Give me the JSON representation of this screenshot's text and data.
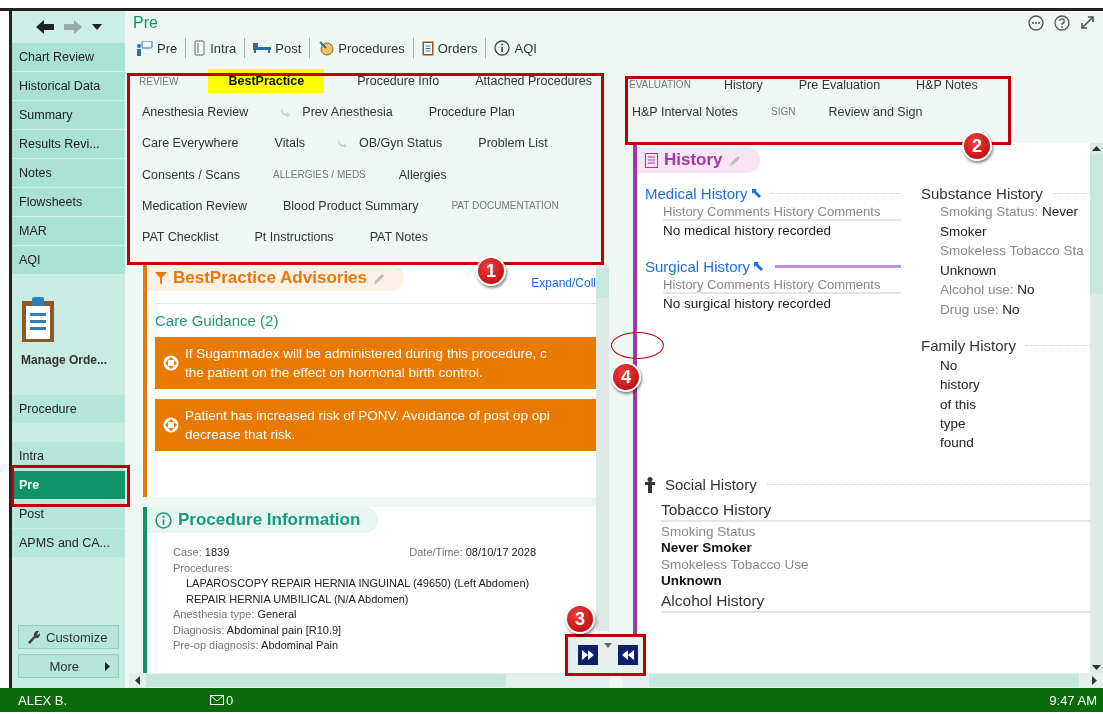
{
  "sidebar": {
    "items": [
      {
        "label": "Chart Review",
        "selected": false
      },
      {
        "label": "Historical Data",
        "selected": false
      },
      {
        "label": "Summary",
        "selected": false
      },
      {
        "label": "Results Revi...",
        "selected": false
      },
      {
        "label": "Notes",
        "selected": false
      },
      {
        "label": "Flowsheets",
        "selected": false
      },
      {
        "label": "MAR",
        "selected": false
      },
      {
        "label": "AQI",
        "selected": false
      }
    ],
    "manage_orders": "Manage Orde...",
    "activities": [
      {
        "label": "Procedure",
        "selected": false
      },
      {
        "label": "Intra",
        "selected": false
      },
      {
        "label": "Pre",
        "selected": true
      },
      {
        "label": "Post",
        "selected": false
      },
      {
        "label": "APMS and CA...",
        "selected": false
      }
    ],
    "customize": "Customize",
    "more": "More"
  },
  "header": {
    "title": "Pre"
  },
  "toolbar": [
    {
      "label": "Pre",
      "kind": "pre"
    },
    {
      "label": "Intra",
      "kind": "intra"
    },
    {
      "label": "Post",
      "kind": "post"
    },
    {
      "label": "Procedures",
      "kind": "procedures"
    },
    {
      "label": "Orders",
      "kind": "orders"
    },
    {
      "label": "AQI",
      "kind": "info"
    }
  ],
  "left_nav": {
    "rows": [
      [
        {
          "label": "REVIEW",
          "kind": "header"
        },
        {
          "label": "BestPractice",
          "kind": "link",
          "selected": true
        },
        {
          "label": "Procedure Info",
          "kind": "link",
          "selected": false
        },
        {
          "label": "Attached Procedures",
          "kind": "link",
          "selected": false
        }
      ],
      [
        {
          "label": "Anesthesia Review",
          "kind": "link",
          "selected": false
        },
        {
          "label": "Prev Anesthesia",
          "kind": "sublink",
          "selected": false
        },
        {
          "label": "Procedure Plan",
          "kind": "link",
          "selected": false
        }
      ],
      [
        {
          "label": "Care Everywhere",
          "kind": "link",
          "selected": false
        },
        {
          "label": "Vitals",
          "kind": "link",
          "selected": false
        },
        {
          "label": "OB/Gyn Status",
          "kind": "sublink",
          "selected": false
        },
        {
          "label": "Problem List",
          "kind": "link",
          "selected": false
        }
      ],
      [
        {
          "label": "Consents / Scans",
          "kind": "link",
          "selected": false
        },
        {
          "label": "ALLERGIES / MEDS",
          "kind": "header"
        },
        {
          "label": "Allergies",
          "kind": "link",
          "selected": false
        }
      ],
      [
        {
          "label": "Medication Review",
          "kind": "link",
          "selected": false
        },
        {
          "label": "Blood Product Summary",
          "kind": "link",
          "selected": false
        },
        {
          "label": "PAT DOCUMENTATION",
          "kind": "header"
        }
      ],
      [
        {
          "label": "PAT Checklist",
          "kind": "link",
          "selected": false
        },
        {
          "label": "Pt Instructions",
          "kind": "link",
          "selected": false
        },
        {
          "label": "PAT Notes",
          "kind": "link",
          "selected": false
        }
      ]
    ]
  },
  "advisories": {
    "title": "BestPractice Advisories",
    "expand_link": "Expand/Coll",
    "group": "Care Guidance (2)",
    "alerts": [
      {
        "lines": [
          "If Sugammadex will be administered during this procedure, c",
          "the patient on the effect on hormonal birth control."
        ]
      },
      {
        "lines": [
          "Patient has increased risk of PONV. Avoidance of post op opi",
          "decrease that risk."
        ]
      }
    ]
  },
  "procedure_info": {
    "title": "Procedure Information",
    "case": {
      "label": "Case:",
      "value": "1839"
    },
    "datetime": {
      "label": "Date/Time:",
      "value": "08/10/17 2028"
    },
    "procedures_label": "Procedures:",
    "procedures": [
      "LAPAROSCOPY REPAIR HERNIA INGUINAL (49650) (Left Abdomen)",
      "REPAIR HERNIA UMBILICAL (N/A Abdomen)"
    ],
    "fields": [
      {
        "label": "Anesthesia type:",
        "value": "General"
      },
      {
        "label": "Diagnosis:",
        "value": "Abdominal pain [R10.9]"
      },
      {
        "label": "Pre-op diagnosis:",
        "value": "Abdominal Pain"
      }
    ]
  },
  "right_nav": {
    "rows": [
      [
        {
          "label": "EVALUATION",
          "kind": "header"
        },
        {
          "label": "History",
          "kind": "link",
          "selected": false
        },
        {
          "label": "Pre Evaluation",
          "kind": "link",
          "selected": false
        },
        {
          "label": "H&P Notes",
          "kind": "link",
          "selected": false
        }
      ],
      [
        {
          "label": "H&P Interval Notes",
          "kind": "link",
          "selected": false
        },
        {
          "label": "SIGN",
          "kind": "header"
        },
        {
          "label": "Review and Sign",
          "kind": "link",
          "selected": false
        }
      ]
    ]
  },
  "history": {
    "title": "History",
    "medical": {
      "title": "Medical History",
      "comments": "History Comments History Comments",
      "text": "No medical history recorded"
    },
    "surgical": {
      "title": "Surgical History",
      "comments": "History Comments History Comments",
      "text": "No surgical history recorded"
    },
    "substance": {
      "title": "Substance History",
      "entries": [
        {
          "label": "Smoking Status:",
          "value": "Never Smoker"
        },
        {
          "label": "Smokeless Tobacco Sta",
          "value": "Unknown"
        },
        {
          "label": "Alcohol use:",
          "value": "No"
        },
        {
          "label": "Drug use:",
          "value": "No"
        }
      ]
    },
    "family": {
      "title": "Family History",
      "text": "No history of this type found"
    },
    "social": {
      "title": "Social History",
      "tobacco_title": "Tobacco History",
      "entries": [
        {
          "label": "Smoking Status",
          "value": "Never Smoker"
        },
        {
          "label": "Smokeless Tobacco Use",
          "value": "Unknown"
        }
      ],
      "alcohol_title": "Alcohol History"
    }
  },
  "status_bar": {
    "user": "ALEX B.",
    "messages": "0",
    "time": "9:47 AM"
  },
  "callouts": [
    {
      "number": "1"
    },
    {
      "number": "2"
    },
    {
      "number": "3"
    },
    {
      "number": "4"
    }
  ]
}
